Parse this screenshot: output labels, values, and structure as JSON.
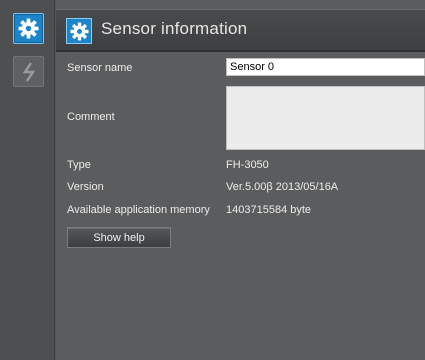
{
  "sidebar": {
    "items": [
      {
        "icon": "gear-icon",
        "active": true
      },
      {
        "icon": "lightning-icon",
        "active": false
      }
    ]
  },
  "header": {
    "icon": "gear-icon",
    "title": "Sensor information"
  },
  "form": {
    "sensor_name": {
      "label": "Sensor name",
      "value": "Sensor 0"
    },
    "comment": {
      "label": "Comment",
      "value": ""
    },
    "type": {
      "label": "Type",
      "value": "FH-3050"
    },
    "version": {
      "label": "Version",
      "value": "Ver.5.00β 2013/05/16A"
    },
    "memory": {
      "label": "Available application memory",
      "value": "1403715584 byte"
    }
  },
  "help_button": {
    "label": "Show help"
  },
  "colors": {
    "accent": "#1c84c8",
    "background": "#5b5c5d",
    "header": "#434445"
  }
}
